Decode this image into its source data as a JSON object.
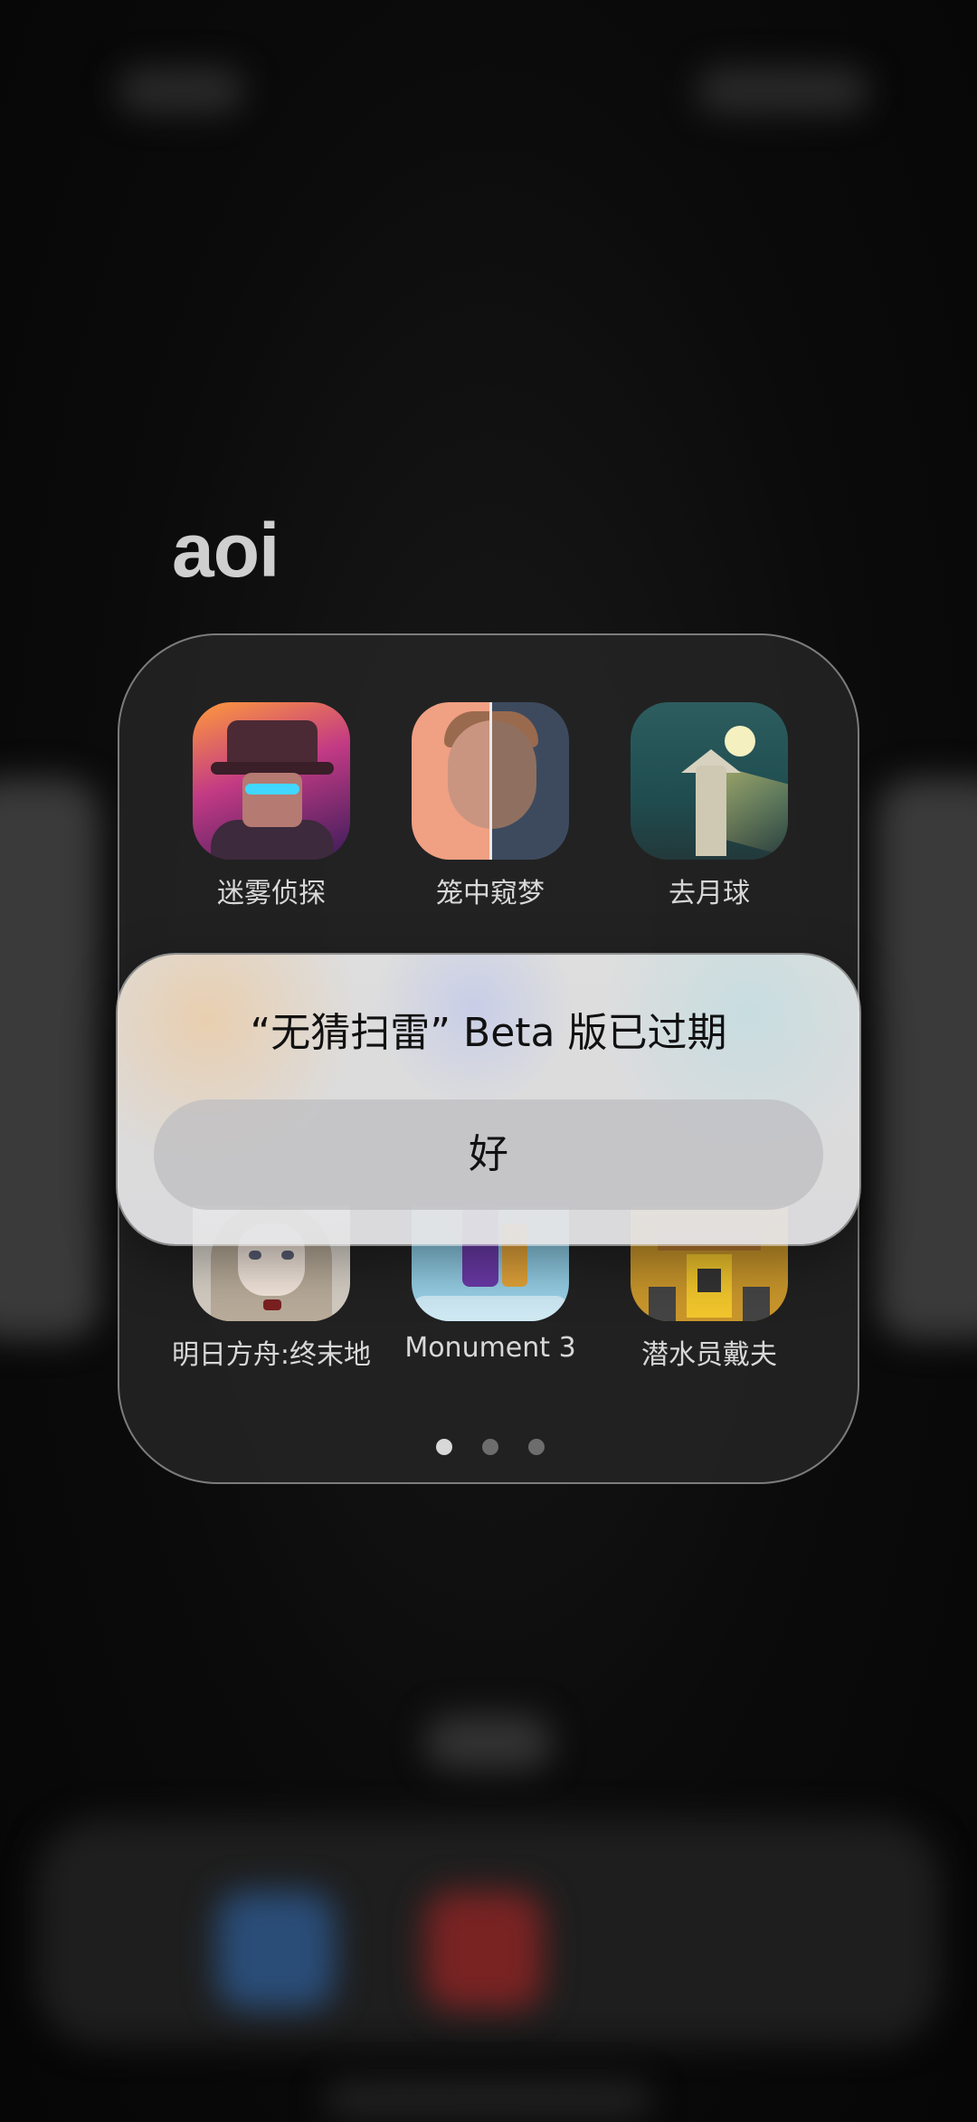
{
  "folder": {
    "title": "aoi",
    "apps": [
      {
        "name": "迷雾侦探",
        "icon": "detective-icon"
      },
      {
        "name": "笼中窥梦",
        "icon": "split-face-icon"
      },
      {
        "name": "去月球",
        "icon": "lighthouse-moon-icon"
      },
      {
        "name": "明日方舟:终末地",
        "icon": "anime-girl-icon"
      },
      {
        "name": "Monument 3",
        "icon": "monument-icon"
      },
      {
        "name": "潜水员戴夫",
        "icon": "pixel-dave-icon"
      }
    ],
    "page_count": 3,
    "current_page": 1
  },
  "alert": {
    "title": "“无猜扫雷” Beta 版已过期",
    "button_label": "好"
  },
  "colors": {
    "background": "#050505",
    "folder_border": "#c8c8c8",
    "alert_background": "#ececec",
    "alert_button": "#bebec0",
    "dot_active": "#d8d8d8",
    "dot_inactive": "#6d6d6d"
  }
}
